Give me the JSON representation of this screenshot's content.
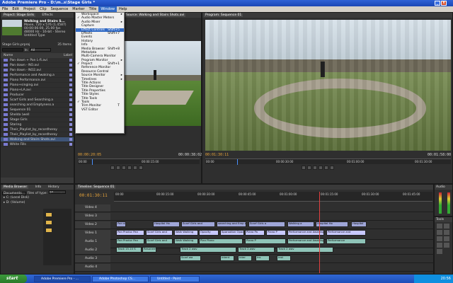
{
  "window": {
    "title": "Adobe Premiere Pro - D:\\m..s\\Stage Girls *"
  },
  "menubar": [
    "File",
    "Edit",
    "Project",
    "Clip",
    "Sequence",
    "Marker",
    "Title",
    "Window",
    "Help"
  ],
  "window_menu": {
    "items": [
      {
        "label": "Workspace",
        "check": false,
        "arrow": true,
        "shortcut": ""
      },
      {
        "label": "Audio Master Meters",
        "check": true,
        "arrow": false,
        "shortcut": ""
      },
      {
        "label": "Audio Mixer",
        "check": false,
        "arrow": true,
        "shortcut": ""
      },
      {
        "label": "Capture",
        "check": false,
        "arrow": false,
        "shortcut": ""
      },
      {
        "label": "Effect Controls",
        "check": false,
        "arrow": false,
        "shortcut": "Shift+5",
        "highlight": true
      },
      {
        "label": "Effects",
        "check": false,
        "arrow": false,
        "shortcut": "Shift+7"
      },
      {
        "label": "Events",
        "check": false,
        "arrow": false,
        "shortcut": ""
      },
      {
        "label": "History",
        "check": false,
        "arrow": false,
        "shortcut": ""
      },
      {
        "label": "Info",
        "check": false,
        "arrow": false,
        "shortcut": ""
      },
      {
        "label": "Media Browser",
        "check": false,
        "arrow": false,
        "shortcut": "Shift+8"
      },
      {
        "label": "Metadata",
        "check": false,
        "arrow": false,
        "shortcut": ""
      },
      {
        "label": "Multi-Camera Monitor",
        "check": false,
        "arrow": false,
        "shortcut": ""
      },
      {
        "label": "Program Monitor",
        "check": false,
        "arrow": true,
        "shortcut": ""
      },
      {
        "label": "Project",
        "check": true,
        "arrow": false,
        "shortcut": "Shift+1"
      },
      {
        "label": "Reference Monitor",
        "check": false,
        "arrow": false,
        "shortcut": ""
      },
      {
        "label": "Resource Central",
        "check": false,
        "arrow": false,
        "shortcut": ""
      },
      {
        "label": "Source Monitor",
        "check": false,
        "arrow": true,
        "shortcut": ""
      },
      {
        "label": "Timelines",
        "check": false,
        "arrow": true,
        "shortcut": ""
      },
      {
        "label": "Title Actions",
        "check": false,
        "arrow": false,
        "shortcut": ""
      },
      {
        "label": "Title Designer",
        "check": false,
        "arrow": false,
        "shortcut": ""
      },
      {
        "label": "Title Properties",
        "check": false,
        "arrow": false,
        "shortcut": ""
      },
      {
        "label": "Title Styles",
        "check": false,
        "arrow": false,
        "shortcut": ""
      },
      {
        "label": "Title Tools",
        "check": false,
        "arrow": false,
        "shortcut": ""
      },
      {
        "label": "Tools",
        "check": true,
        "arrow": false,
        "shortcut": ""
      },
      {
        "label": "Trim Monitor",
        "check": false,
        "arrow": false,
        "shortcut": "T"
      },
      {
        "label": "VST Editor",
        "check": false,
        "arrow": false,
        "shortcut": ""
      }
    ]
  },
  "project": {
    "tabs": [
      "Project: Stage Girls",
      "Effects"
    ],
    "clip_name": "Walking and Stairs S...",
    "clip_info1": "Movie, 720 x 576 (1.4587)",
    "clip_info2": "00:00:06:00, 25.00 fps",
    "clip_info3": "48000 Hz - 16-bit - Stereo",
    "clip_info4": "Untitled Type",
    "file": "Stage Girls.prproj",
    "count": "35 Items",
    "in_label": "In:",
    "in_value": "All",
    "col_name": "Name",
    "col_label": "Label",
    "items": [
      "Pan down + Pan L-R.avi",
      "Pan down - NO.avi",
      "Pan down - NO2.avi",
      "Performance and Awaking.a",
      "Piano Performance.avi",
      "Piano+singing.avi",
      "Piano+LA.avi",
      "Producer",
      "Scarf Girls and Searching.a",
      "searching and Emptyness.a",
      "Sequence 01",
      "Shelda (well",
      "Stage Girls",
      "Staring",
      "Their_Playlist_by_recordheroy",
      "Their_Playlist_by_recordheroy",
      "Walking and Stairs Shots.avi",
      "White Fills"
    ]
  },
  "source": {
    "tab": "Source: Walking and Stairs Shots.avi",
    "timecode_in": "00:00:20:05",
    "timecode_dur": "00:00:38:02",
    "ruler1": "00:00",
    "ruler2": "00:00:15:00"
  },
  "program": {
    "tab": "Program: Sequence 01",
    "timecode_in": "00:01:30:11",
    "timecode_dur": "00:01:58:00",
    "ruler1": "00:00",
    "ruler2": "00:00:30:00",
    "ruler3": "00:01:00:00",
    "ruler4": "00:01:30:00"
  },
  "media_browser": {
    "tabs": [
      "Media Browser",
      "Info",
      "History"
    ],
    "view_label": "Documents",
    "files_label": "Files of type:",
    "files_value": "All Supported",
    "drives": [
      "C: (Local Disk)",
      "D: (Volume)"
    ]
  },
  "timeline": {
    "tab": "Timeline: Sequence 01",
    "timecode": "00:01:30:11",
    "ruler": [
      "00:00",
      "00:00:15:00",
      "00:00:30:00",
      "00:00:45:00",
      "00:01:00:00",
      "00:01:15:00",
      "00:01:30:00",
      "00:01:45:00"
    ],
    "tracks": [
      {
        "name": "Video 4",
        "type": "v"
      },
      {
        "name": "Video 3",
        "type": "v"
      },
      {
        "name": "Video 2",
        "type": "v"
      },
      {
        "name": "Video 1",
        "type": "v"
      },
      {
        "name": "Audio 1",
        "type": "a"
      },
      {
        "name": "Audio 2",
        "type": "a"
      },
      {
        "name": "Audio 3",
        "type": "a"
      },
      {
        "name": "Audio 4",
        "type": "a"
      }
    ],
    "clips_v2": [
      "Pan do",
      "Hospital Ho",
      "Scarf Girls and",
      "searching and Emp searching and Empt",
      "Scarf Girls a",
      "Walking a",
      "Hospital Ho",
      "Hospital"
    ],
    "clips_v1": [
      "Pan Produc Pan",
      "Scarf Girls and",
      "Walk Walking",
      "Opacity",
      "Sparsation Opacity",
      "Piano Pa",
      "Piano P",
      "Performance and Awaking a",
      "Performance and"
    ],
    "clips_a1": [
      "Pan Produc Pan",
      "Scarf Girls and",
      "Walk Walking",
      "Pian Piano",
      "Piano P",
      "Performance and Awaking a",
      "Performance"
    ],
    "clips_a2": [
      "Track 15.10 S",
      "Resonemo",
      "Track 2 wav",
      "Track 2.wav",
      "Track 2 wav"
    ],
    "clips_a3": [
      "Scarf wa",
      "Intent",
      "Inter",
      "Ins",
      "Inst"
    ]
  },
  "audio_panel": {
    "label": "Audio"
  },
  "tools_panel": {
    "label": "Tools"
  },
  "taskbar": {
    "start": "start",
    "buttons": [
      "Adobe Premiere Pro - ...",
      "Adobe Photoshop CS...",
      "Untitled - Paint"
    ],
    "clock": "20:56"
  }
}
